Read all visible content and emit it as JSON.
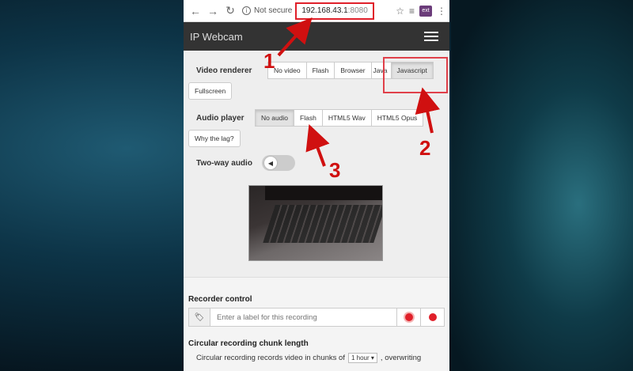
{
  "browser": {
    "not_secure": "Not secure",
    "url_host": "192.168.43.1",
    "url_port": ":8080"
  },
  "app": {
    "title": "IP Webcam"
  },
  "video_renderer": {
    "label": "Video renderer",
    "options": [
      "No video",
      "Flash",
      "Browser",
      "Java",
      "Javascript"
    ],
    "selected": "Javascript",
    "fullscreen": "Fullscreen"
  },
  "audio_player": {
    "label": "Audio player",
    "options": [
      "No audio",
      "Flash",
      "HTML5 Wav",
      "HTML5 Opus"
    ],
    "selected": "No audio",
    "why_lag": "Why the lag?"
  },
  "two_way_audio": {
    "label": "Two-way audio"
  },
  "recorder": {
    "title": "Recorder control",
    "placeholder": "Enter a label for this recording"
  },
  "circular": {
    "title": "Circular recording chunk length",
    "text_before": "Circular recording records video in chunks of",
    "chunk_value": "1 hour",
    "text_after": ", overwriting"
  },
  "annotations": {
    "n1": "1",
    "n2": "2",
    "n3": "3",
    "color": "#d01010"
  }
}
